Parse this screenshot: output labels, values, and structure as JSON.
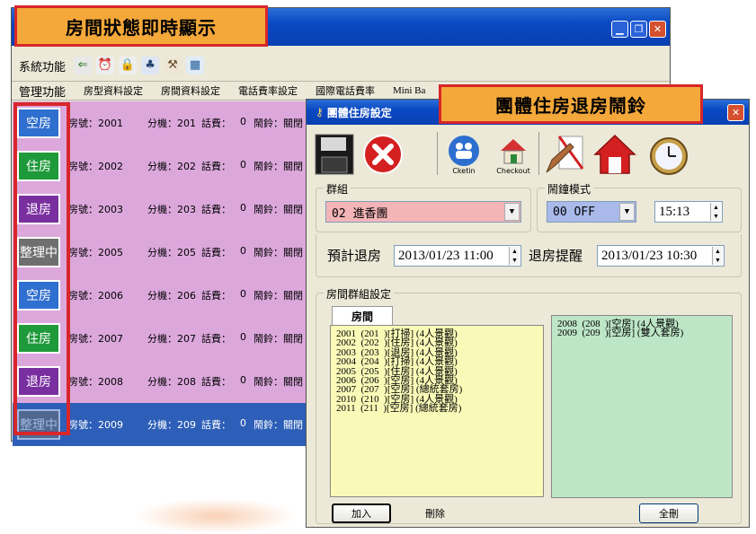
{
  "banner_main": "房間狀態即時顯示",
  "banner_dialog": "團體住房退房鬧鈴",
  "main_window": {
    "toolbar_label": "系統功能",
    "menu": [
      "管理功能",
      "房型資料設定",
      "房間資料設定",
      "電話費率設定",
      "國際電話費率",
      "Mini Ba"
    ],
    "rooms": [
      {
        "status": "空房",
        "room": "房號：2001",
        "ext": "分機：201",
        "fee_label": "話費：",
        "fee": "0",
        "alarm": "鬧鈴：關閉"
      },
      {
        "status": "住房",
        "room": "房號：2002",
        "ext": "分機：202",
        "fee_label": "話費：",
        "fee": "0",
        "alarm": "鬧鈴：關閉"
      },
      {
        "status": "退房",
        "room": "房號：2003",
        "ext": "分機：203",
        "fee_label": "話費：",
        "fee": "0",
        "alarm": "鬧鈴：關閉"
      },
      {
        "status": "整理中",
        "room": "房號：2005",
        "ext": "分機：205",
        "fee_label": "話費：",
        "fee": "0",
        "alarm": "鬧鈴：關閉"
      },
      {
        "status": "空房",
        "room": "房號：2006",
        "ext": "分機：206",
        "fee_label": "話費：",
        "fee": "0",
        "alarm": "鬧鈴：關閉"
      },
      {
        "status": "住房",
        "room": "房號：2007",
        "ext": "分機：207",
        "fee_label": "話費：",
        "fee": "0",
        "alarm": "鬧鈴：關閉"
      },
      {
        "status": "退房",
        "room": "房號：2008",
        "ext": "分機：208",
        "fee_label": "話費：",
        "fee": "0",
        "alarm": "鬧鈴：關閉"
      },
      {
        "status": "整理中",
        "room": "房號：2009",
        "ext": "分機：209",
        "fee_label": "話費：",
        "fee": "0",
        "alarm": "鬧鈴：關閉"
      }
    ],
    "status_colors": {
      "空房": "#2f6fcf",
      "住房": "#1f9a3a",
      "退房": "#7a2fa0",
      "整理中": "#6f6f6f"
    }
  },
  "dialog": {
    "title": "團體住房設定",
    "toolbar": {
      "checkin_label": "Cketin",
      "checkout_label": "Checkout"
    },
    "group_label": "群組",
    "group_value": "02  進香團",
    "alarm_mode_label": "鬧鐘模式",
    "alarm_mode_value": "00 OFF",
    "time_value": "15:13",
    "checkout_label": "預計退房",
    "checkout_value": "2013/01/23 11:00",
    "remind_label": "退房提醒",
    "remind_value": "2013/01/23 10:30",
    "room_group_label": "房間群組設定",
    "tab_label": "房間",
    "left_list": [
      "2001  (201  )[打掃] (4人景觀)",
      "2002  (202  )[住房] (4人景觀)",
      "2003  (203  )[退房] (4人景觀)",
      "2004  (204  )[打掃] (4人景觀)",
      "2005  (205  )[住房] (4人景觀)",
      "2006  (206  )[空房] (4人景觀)",
      "2007  (207  )[空房] (總統套房)",
      "2010  (210  )[空房] (4人景觀)",
      "2011  (211  )[空房] (總統套房)"
    ],
    "right_list": [
      "2008  (208  )[空房] (4人景觀)",
      "2009  (209  )[空房] (雙人套房)"
    ],
    "add_button": "加入",
    "delete_button": "刪除",
    "delete_all_button": "全刪"
  }
}
